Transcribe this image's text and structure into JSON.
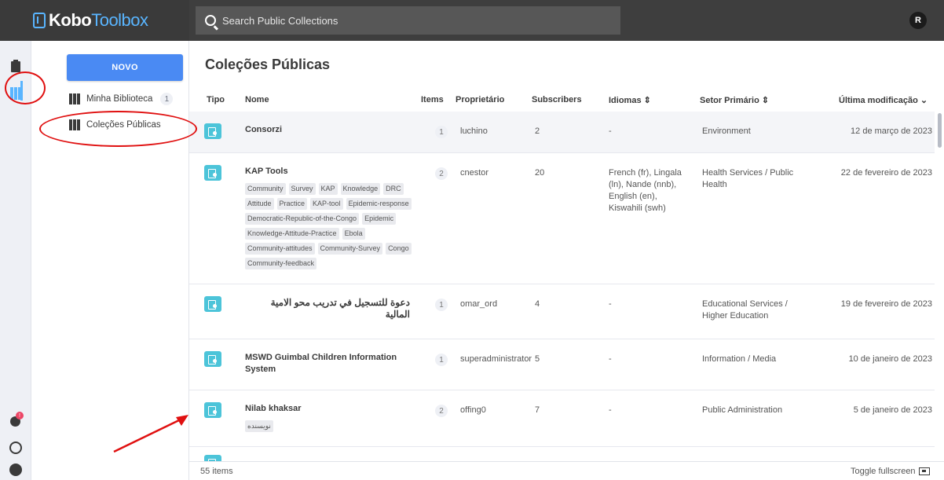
{
  "app": {
    "logo_kobo": "Kobo",
    "logo_toolbox": "Toolbox",
    "search_placeholder": "Search Public Collections",
    "avatar_initial": "R"
  },
  "sidebar": {
    "new_button": "NOVO",
    "items": [
      {
        "label": "Minha Biblioteca",
        "count": "1"
      },
      {
        "label": "Coleções Públicas"
      }
    ]
  },
  "main": {
    "title": "Coleções Públicas",
    "columns": {
      "tipo": "Tipo",
      "nome": "Nome",
      "items": "Items",
      "proprietario": "Proprietário",
      "subscribers": "Subscribers",
      "idiomas": "Idiomas",
      "setor": "Setor Primário",
      "modificacao": "Última modificação"
    },
    "rows": [
      {
        "name": "Consorzi",
        "tags": [],
        "items": "1",
        "owner": "luchino",
        "subscribers": "2",
        "languages": "-",
        "sector": "Environment",
        "modified": "12 de março de 2023"
      },
      {
        "name": "KAP Tools",
        "tags": [
          "Community",
          "Survey",
          "KAP",
          "Knowledge",
          "DRC",
          "Attitude",
          "Practice",
          "KAP-tool",
          "Epidemic-response",
          "Democratic-Republic-of-the-Congo",
          "Epidemic",
          "Knowledge-Attitude-Practice",
          "Ebola",
          "Community-attitudes",
          "Community-Survey",
          "Congo",
          "Community-feedback"
        ],
        "items": "2",
        "owner": "cnestor",
        "subscribers": "20",
        "languages": "French (fr), Lingala (ln), Nande (nnb), English (en), Kiswahili (swh)",
        "sector": "Health Services / Public Health",
        "modified": "22 de fevereiro de 2023"
      },
      {
        "name": "دعوة للتسجيل في تدريب محو الامية المالية",
        "tags": [],
        "items": "1",
        "owner": "omar_ord",
        "subscribers": "4",
        "languages": "-",
        "sector": "Educational Services / Higher Education",
        "modified": "19 de fevereiro de 2023"
      },
      {
        "name": "MSWD Guimbal Children Information System",
        "tags": [],
        "items": "1",
        "owner": "superadministrator",
        "subscribers": "5",
        "languages": "-",
        "sector": "Information / Media",
        "modified": "10 de janeiro de 2023"
      },
      {
        "name": "Nilab khaksar",
        "tags": [
          "نويسنده"
        ],
        "items": "2",
        "owner": "offing0",
        "subscribers": "7",
        "languages": "-",
        "sector": "Public Administration",
        "modified": "5 de janeiro de 2023"
      }
    ]
  },
  "footer": {
    "count": "55 items",
    "toggle": "Toggle fullscreen"
  },
  "colors": {
    "accent": "#59b5ff",
    "new_button": "#4a8af3",
    "type_icon": "#4cc4d9",
    "annotation": "#e01010"
  }
}
